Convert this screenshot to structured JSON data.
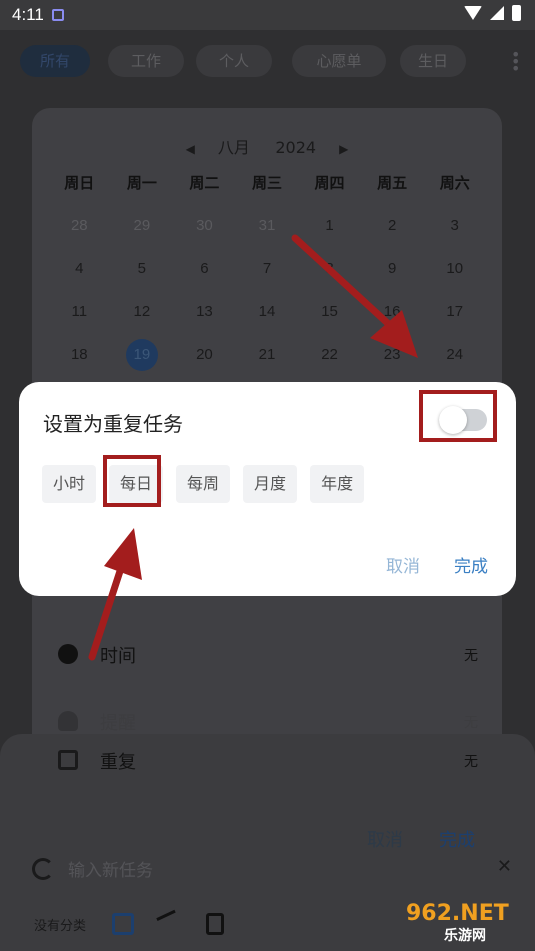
{
  "status_bar": {
    "time": "4:11"
  },
  "tabs": [
    {
      "label": "所有",
      "active": true
    },
    {
      "label": "工作",
      "active": false
    },
    {
      "label": "个人",
      "active": false
    },
    {
      "label": "心愿单",
      "active": false
    },
    {
      "label": "生日",
      "active": false
    }
  ],
  "calendar": {
    "month": "八月",
    "year": "2024",
    "weekdays": [
      "周日",
      "周一",
      "周二",
      "周三",
      "周四",
      "周五",
      "周六"
    ],
    "days": [
      [
        "28",
        "29",
        "30",
        "31",
        "1",
        "2",
        "3"
      ],
      [
        "4",
        "5",
        "6",
        "7",
        "8",
        "9",
        "10"
      ],
      [
        "11",
        "12",
        "13",
        "14",
        "15",
        "16",
        "17"
      ],
      [
        "18",
        "19",
        "20",
        "21",
        "22",
        "23",
        "24"
      ]
    ],
    "selected_day": "19"
  },
  "settings": {
    "time_label": "时间",
    "time_value": "无",
    "reminder_label": "提醒",
    "reminder_value": "无",
    "repeat_label": "重复",
    "repeat_value": "无"
  },
  "bottom_panel": {
    "cancel": "取消",
    "done": "完成",
    "task_placeholder": "输入新任务",
    "no_category": "没有分类"
  },
  "repeat_dialog": {
    "title": "设置为重复任务",
    "toggle_on": false,
    "options": [
      "小时",
      "每日",
      "每周",
      "月度",
      "年度"
    ],
    "cancel": "取消",
    "done": "完成"
  },
  "watermark": {
    "text": "962.NET",
    "subtext": "乐游网"
  },
  "colors": {
    "annotation": "#a31d1d",
    "accent": "#3a7fc3"
  }
}
